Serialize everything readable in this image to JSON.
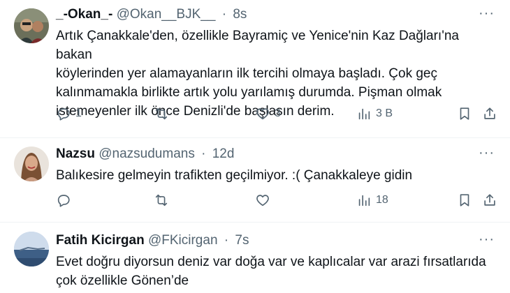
{
  "tweets": [
    {
      "name": "_-Okan_-",
      "handle": "@Okan__BJK__",
      "separator": "·",
      "time": "8s",
      "more": "···",
      "text_lines": [
        "Artık Çanakkale'den, özellikle Bayramiç ve Yenice'nin Kaz Dağları'na bakan",
        "köylerinden yer alamayanların ilk tercihi olmaya başladı. Çok geç",
        "kalınmamakla birlikte artık yolu yarılamış durumda. Pişman olmak",
        "istemeyenler ilk önce Denizli'de başlasın derim."
      ],
      "replies": "1",
      "retweets": "",
      "likes": "3",
      "views": "3 B"
    },
    {
      "name": "Nazsu",
      "handle": "@nazsudumans",
      "separator": "·",
      "time": "12d",
      "more": "···",
      "text_lines": [
        "Balıkesire gelmeyin trafikten geçilmiyor. :( Çanakkaleye gidin"
      ],
      "replies": "",
      "retweets": "",
      "likes": "",
      "views": "18"
    },
    {
      "name": "Fatih Kicirgan",
      "handle": "@FKicirgan",
      "separator": "·",
      "time": "7s",
      "more": "···",
      "text_lines": [
        "Evet doğru diyorsun deniz var doğa var ve kaplıcalar var arazi fırsatlarıda",
        "çok özellikle Gönen’de"
      ]
    }
  ],
  "icons": [
    "reply-icon",
    "retweet-icon",
    "like-icon",
    "views-icon",
    "bookmark-icon",
    "share-icon"
  ],
  "colors": {
    "text": "#0f1419",
    "secondary": "#536471",
    "divider": "#eff3f4"
  }
}
